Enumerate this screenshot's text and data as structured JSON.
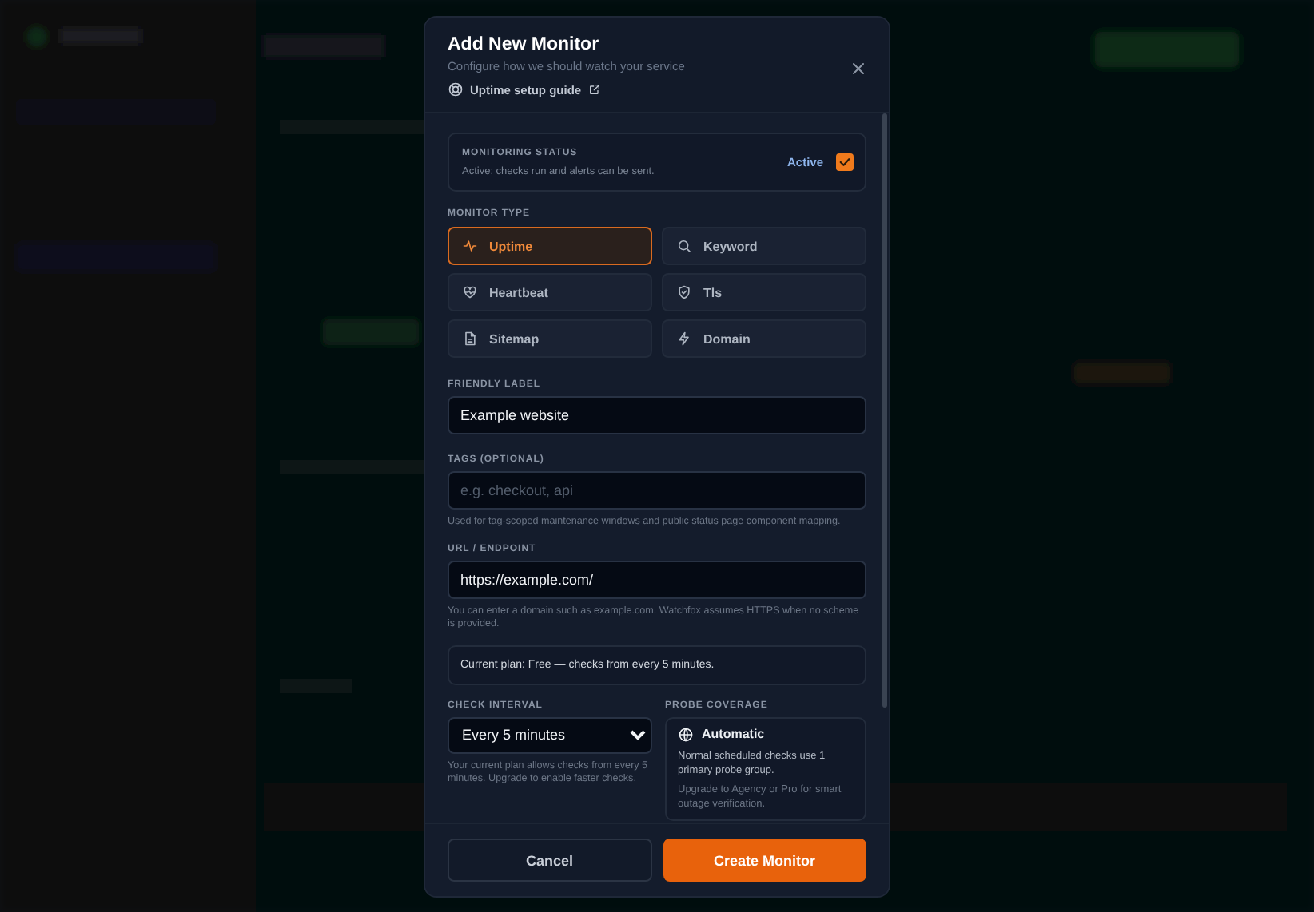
{
  "modal": {
    "title": "Add New Monitor",
    "subtitle": "Configure how we should watch your service",
    "guide_link": "Uptime setup guide",
    "status": {
      "label": "MONITORING STATUS",
      "description": "Active: checks run and alerts can be sent.",
      "state_label": "Active",
      "checked": true
    },
    "monitor_type": {
      "label": "MONITOR TYPE",
      "options": [
        {
          "label": "Uptime",
          "selected": true
        },
        {
          "label": "Keyword",
          "selected": false
        },
        {
          "label": "Heartbeat",
          "selected": false
        },
        {
          "label": "Tls",
          "selected": false
        },
        {
          "label": "Sitemap",
          "selected": false
        },
        {
          "label": "Domain",
          "selected": false
        }
      ]
    },
    "friendly_label": {
      "label": "FRIENDLY LABEL",
      "value": "Example website"
    },
    "tags": {
      "label": "TAGS (OPTIONAL)",
      "placeholder": "e.g. checkout, api",
      "hint": "Used for tag-scoped maintenance windows and public status page component mapping."
    },
    "url": {
      "label": "URL / ENDPOINT",
      "value": "https://example.com/",
      "hint": "You can enter a domain such as example.com. Watchfox assumes HTTPS when no scheme is provided."
    },
    "plan_notice": "Current plan: Free — checks from every 5 minutes.",
    "check_interval": {
      "label": "CHECK INTERVAL",
      "value": "Every 5 minutes",
      "hint": "Your current plan allows checks from every 5 minutes. Upgrade to enable faster checks."
    },
    "probe_coverage": {
      "label": "PROBE COVERAGE",
      "title": "Automatic",
      "description": "Normal scheduled checks use 1 primary probe group.",
      "upgrade_note": "Upgrade to Agency or Pro for smart outage verification."
    },
    "buttons": {
      "cancel": "Cancel",
      "submit": "Create Monitor"
    }
  }
}
